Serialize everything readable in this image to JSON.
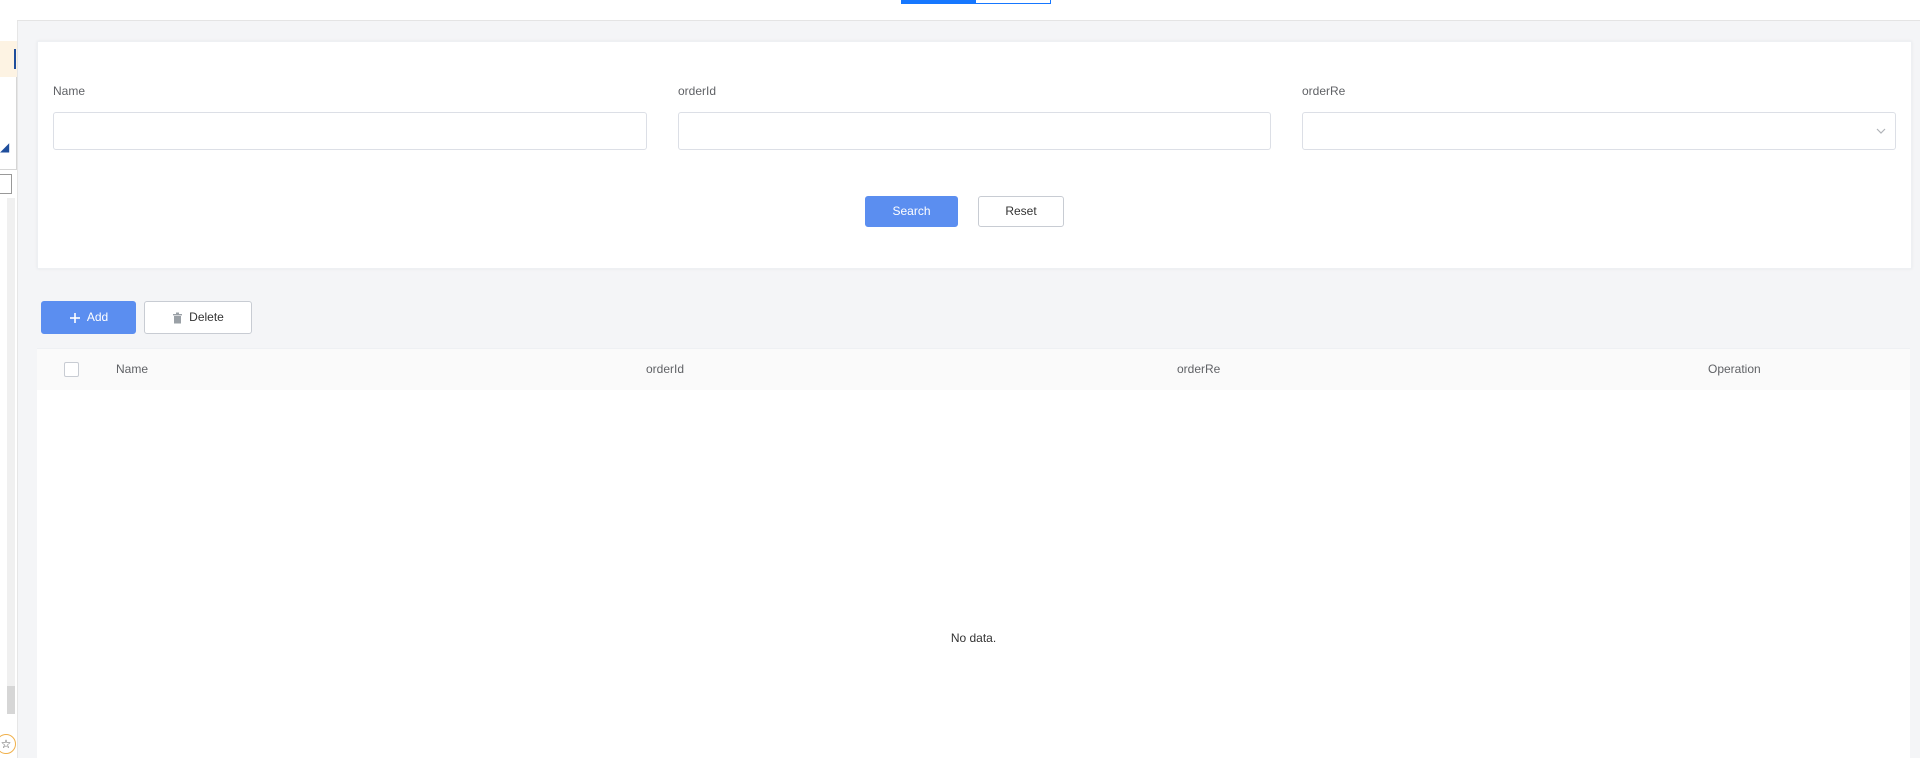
{
  "search_form": {
    "fields": [
      {
        "label": "Name",
        "value": "",
        "placeholder": ""
      },
      {
        "label": "orderId",
        "value": "",
        "placeholder": ""
      },
      {
        "label": "orderRe",
        "value": "",
        "placeholder": ""
      }
    ],
    "search_label": "Search",
    "reset_label": "Reset"
  },
  "toolbar": {
    "add_label": "Add",
    "delete_label": "Delete"
  },
  "table": {
    "columns": [
      "Name",
      "orderId",
      "orderRe",
      "Operation"
    ],
    "rows": [],
    "empty_text": "No data."
  },
  "colors": {
    "primary": "#5b8ef0",
    "top_tab_active": "#1677ff"
  },
  "icons": [
    "plus-icon",
    "trash-icon",
    "chevron-down-icon",
    "star-icon"
  ]
}
